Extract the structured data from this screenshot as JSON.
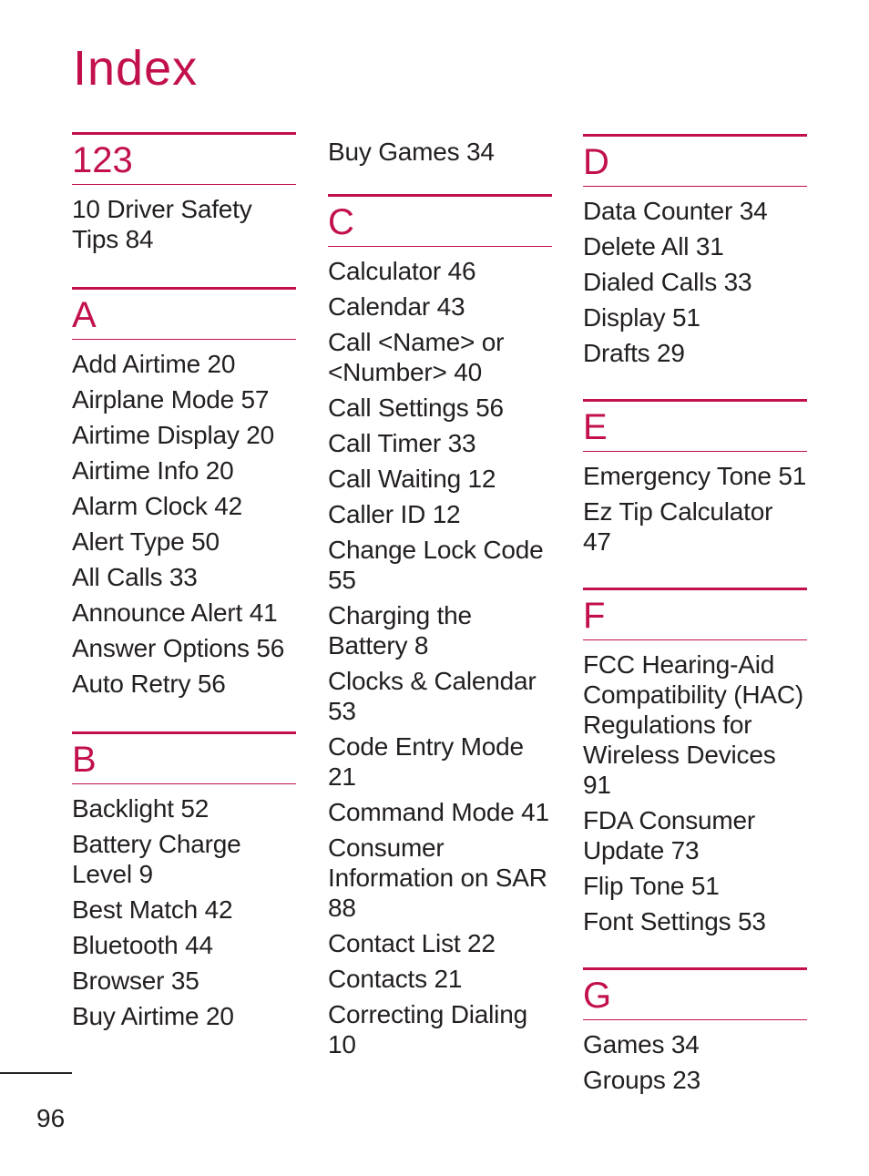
{
  "title": "Index",
  "accent_color": "#c2104b",
  "columns": [
    {
      "lead_entries": [],
      "sections": [
        {
          "letter": "123",
          "entries": [
            "10 Driver Safety Tips 84"
          ]
        },
        {
          "letter": "A",
          "entries": [
            "Add Airtime 20",
            "Airplane Mode 57",
            "Airtime Display 20",
            "Airtime Info 20",
            "Alarm Clock 42",
            "Alert Type 50",
            "All Calls 33",
            "Announce Alert 41",
            "Answer Options 56",
            "Auto Retry 56"
          ]
        },
        {
          "letter": "B",
          "entries": [
            "Backlight 52",
            "Battery Charge Level 9",
            "Best Match 42",
            "Bluetooth 44",
            "Browser 35",
            "Buy Airtime 20"
          ]
        }
      ]
    },
    {
      "lead_entries": [
        "Buy Games 34"
      ],
      "sections": [
        {
          "letter": "C",
          "entries": [
            "Calculator 46",
            "Calendar 43",
            "Call <Name> or <Number> 40",
            "Call Settings 56",
            "Call Timer 33",
            "Call Waiting 12",
            "Caller ID 12",
            "Change Lock Code 55",
            "Charging the Battery 8",
            "Clocks & Calendar 53",
            "Code Entry Mode 21",
            "Command Mode 41",
            "Consumer Information on SAR 88",
            "Contact List 22",
            "Contacts 21",
            "Correcting Dialing 10"
          ]
        }
      ]
    },
    {
      "lead_entries": [],
      "sections": [
        {
          "letter": "D",
          "entries": [
            "Data Counter 34",
            "Delete All 31",
            "Dialed Calls 33",
            "Display 51",
            "Drafts 29"
          ]
        },
        {
          "letter": "E",
          "entries": [
            "Emergency Tone 51",
            "Ez Tip Calculator 47"
          ]
        },
        {
          "letter": "F",
          "entries": [
            "FCC Hearing-Aid Compatibility (HAC) Regulations for Wireless Devices 91",
            "FDA Consumer Update 73",
            "Flip Tone 51",
            "Font Settings 53"
          ]
        },
        {
          "letter": "G",
          "entries": [
            "Games 34",
            "Groups 23"
          ]
        }
      ]
    }
  ],
  "footer": {
    "page_number": "96"
  }
}
